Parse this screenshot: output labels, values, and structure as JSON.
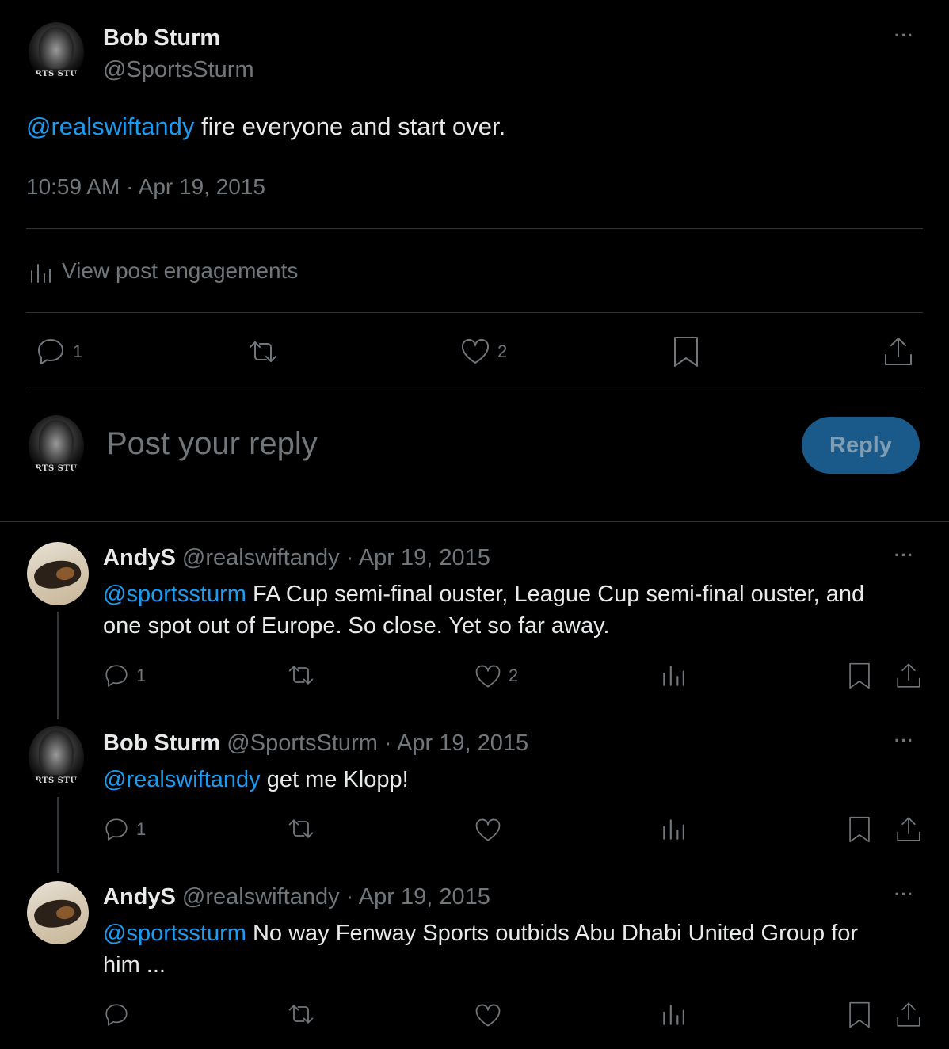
{
  "main_post": {
    "author_name": "Bob Sturm",
    "author_handle": "@SportsSturm",
    "avatar_caption": "RTS STU",
    "mention": "@realswiftandy",
    "text": " fire everyone and start over.",
    "timestamp": "10:59 AM · Apr 19, 2015",
    "engagements_label": "View post engagements",
    "reply_count": "1",
    "like_count": "2"
  },
  "composer": {
    "placeholder": "Post your reply",
    "reply_button": "Reply",
    "avatar_caption": "RTS STU"
  },
  "replies": [
    {
      "author_name": "AndyS",
      "meta": "@realswiftandy · Apr 19, 2015",
      "mention": "@sportssturm",
      "text_line1": " FA Cup semi-final ouster, League Cup semi-final ouster, and",
      "text_line2": "one spot out of Europe. So close. Yet so far away.",
      "reply_count": "1",
      "like_count": "2"
    },
    {
      "author_name": "Bob Sturm",
      "meta": "@SportsSturm · Apr 19, 2015",
      "mention": "@realswiftandy",
      "text_line1": " get me Klopp!",
      "avatar_caption": "RTS STU",
      "reply_count": "1"
    },
    {
      "author_name": "AndyS",
      "meta": "@realswiftandy · Apr 19, 2015",
      "mention": "@sportssturm",
      "text_line1": " No way Fenway Sports outbids Abu Dhabi United Group for",
      "text_line2": "him ..."
    }
  ],
  "more_label": "···",
  "colors": {
    "background": "#000000",
    "text": "#e7e9ea",
    "muted": "#71767b",
    "link": "#1d9bf0",
    "reply_button_bg": "#1a5a8a",
    "divider": "#2f3336"
  },
  "icons": [
    "reply-icon",
    "repost-icon",
    "like-icon",
    "bookmark-icon",
    "share-icon",
    "views-icon",
    "more-icon"
  ]
}
